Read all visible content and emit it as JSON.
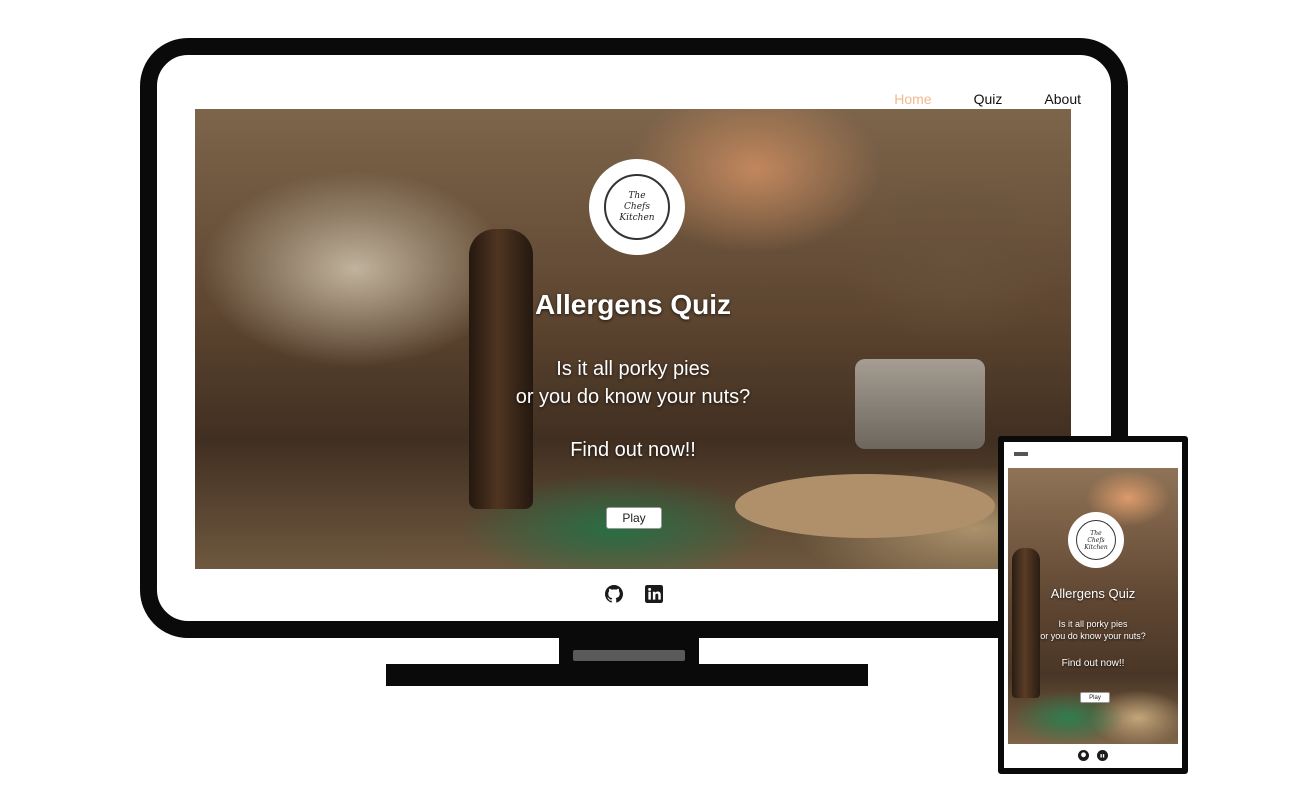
{
  "desktop": {
    "nav": {
      "items": [
        {
          "label": "Home",
          "active": true
        },
        {
          "label": "Quiz",
          "active": false
        },
        {
          "label": "About",
          "active": false
        }
      ]
    },
    "hero": {
      "logo_text": "The\nChefs\nKitchen",
      "title": "Allergens Quiz",
      "subtitle_line1": "Is it all porky pies",
      "subtitle_line2": "or you do know your nuts?",
      "cta": "Find out now!!",
      "play_label": "Play"
    },
    "footer": {
      "icons": [
        "github-icon",
        "linkedin-icon"
      ]
    }
  },
  "mobile": {
    "hero": {
      "logo_text": "The\nChefs\nKitchen",
      "title": "Allergens Quiz",
      "subtitle_line1": "Is it all porky pies",
      "subtitle_line2": "or you do know your nuts?",
      "cta": "Find out now!!",
      "play_label": "Play"
    },
    "footer": {
      "icons": [
        "github-icon",
        "linkedin-icon"
      ]
    }
  },
  "colors": {
    "nav_active": "#f0b98c",
    "nav_text": "#111111",
    "device_frame": "#0a0a0a",
    "hero_text": "#ffffff"
  }
}
